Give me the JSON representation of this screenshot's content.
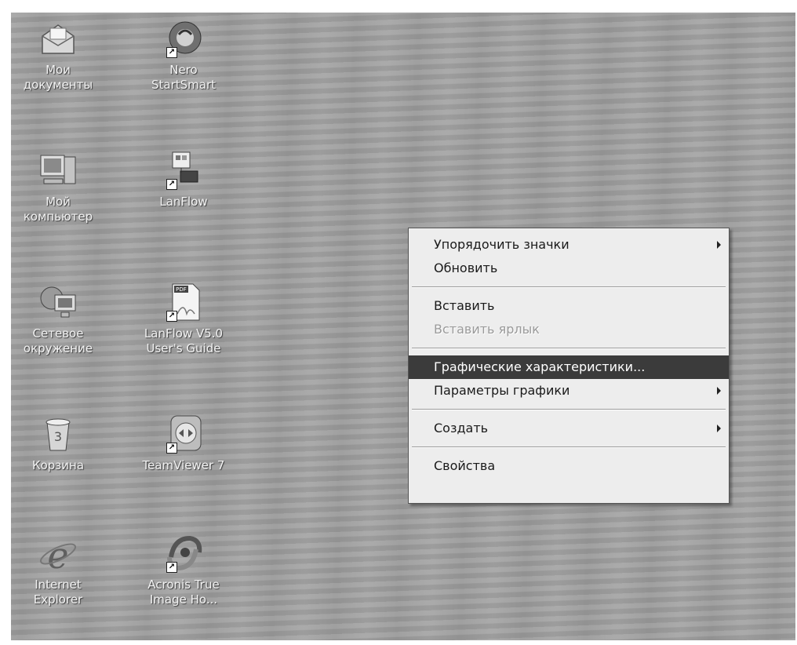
{
  "desktop": {
    "icons": [
      {
        "label": "Мои\nдокументы",
        "icon": "my-documents-icon"
      },
      {
        "label": "Nero\nStartSmart",
        "icon": "nero-icon",
        "shortcut": true
      },
      {
        "label": "Мой\nкомпьютер",
        "icon": "my-computer-icon"
      },
      {
        "label": "LanFlow",
        "icon": "lanflow-icon",
        "shortcut": true
      },
      {
        "label": "Сетевое\nокружение",
        "icon": "network-icon"
      },
      {
        "label": "LanFlow V5.0\nUser's Guide",
        "icon": "pdf-icon",
        "shortcut": true
      },
      {
        "label": "Корзина",
        "icon": "recycle-bin-icon"
      },
      {
        "label": "TeamViewer 7",
        "icon": "teamviewer-icon",
        "shortcut": true
      },
      {
        "label": "Internet\nExplorer",
        "icon": "internet-explorer-icon"
      },
      {
        "label": "Acronis True\nImage Ho...",
        "icon": "acronis-icon",
        "shortcut": true
      }
    ]
  },
  "context_menu": {
    "items": [
      {
        "label": "Упорядочить значки",
        "submenu": true
      },
      {
        "label": "Обновить"
      },
      {
        "label": "Вставить"
      },
      {
        "label": "Вставить ярлык",
        "disabled": true
      },
      {
        "label": "Графические характеристики...",
        "highlighted": true
      },
      {
        "label": "Параметры графики",
        "submenu": true
      },
      {
        "label": "Создать",
        "submenu": true
      },
      {
        "label": "Свойства"
      }
    ]
  },
  "colors": {
    "desktop_bg": "#a3a3a3",
    "menu_bg": "#ededed",
    "highlight": "#3b3b3b"
  }
}
